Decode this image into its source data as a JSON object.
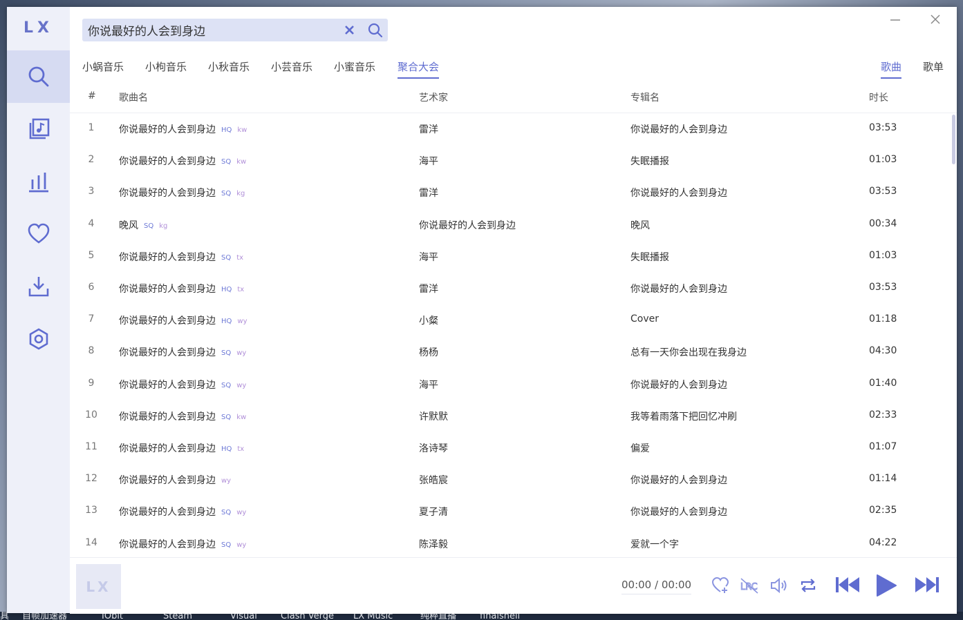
{
  "app": {
    "logo": "LX"
  },
  "colors": {
    "accent": "#5f6cd0",
    "quality_tag": "#6d79d6",
    "source_tag": "#b08fd8",
    "sidebar_bg": "#eef0f9"
  },
  "sidebar": {
    "items": [
      {
        "icon": "search-icon",
        "active": true
      },
      {
        "icon": "music-file-icon",
        "active": false
      },
      {
        "icon": "chart-icon",
        "active": false
      },
      {
        "icon": "heart-icon",
        "active": false
      },
      {
        "icon": "download-icon",
        "active": false
      },
      {
        "icon": "settings-icon",
        "active": false
      }
    ]
  },
  "search": {
    "value": "你说最好的人会到身边"
  },
  "source_tabs": [
    {
      "label": "小蜗音乐"
    },
    {
      "label": "小枸音乐"
    },
    {
      "label": "小秋音乐"
    },
    {
      "label": "小芸音乐"
    },
    {
      "label": "小蜜音乐"
    },
    {
      "label": "聚合大会",
      "active": true
    }
  ],
  "type_tabs": [
    {
      "label": "歌曲",
      "active": true
    },
    {
      "label": "歌单"
    }
  ],
  "table": {
    "headers": {
      "num": "#",
      "name": "歌曲名",
      "artist": "艺术家",
      "album": "专辑名",
      "duration": "时长"
    },
    "rows": [
      {
        "num": "1",
        "name": "你说最好的人会到身边",
        "quality": "HQ",
        "source": "kw",
        "artist": "雷洋",
        "album": "你说最好的人会到身边",
        "duration": "03:53"
      },
      {
        "num": "2",
        "name": "你说最好的人会到身边",
        "quality": "SQ",
        "source": "kw",
        "artist": "海平",
        "album": "失眠播报",
        "duration": "01:03"
      },
      {
        "num": "3",
        "name": "你说最好的人会到身边",
        "quality": "SQ",
        "source": "kg",
        "artist": "雷洋",
        "album": "你说最好的人会到身边",
        "duration": "03:53"
      },
      {
        "num": "4",
        "name": "晚风",
        "quality": "SQ",
        "source": "kg",
        "artist": "你说最好的人会到身边",
        "album": "晚风",
        "duration": "00:34"
      },
      {
        "num": "5",
        "name": "你说最好的人会到身边",
        "quality": "SQ",
        "source": "tx",
        "artist": "海平",
        "album": "失眠播报",
        "duration": "01:03"
      },
      {
        "num": "6",
        "name": "你说最好的人会到身边",
        "quality": "HQ",
        "source": "tx",
        "artist": "雷洋",
        "album": "你说最好的人会到身边",
        "duration": "03:53"
      },
      {
        "num": "7",
        "name": "你说最好的人会到身边",
        "quality": "HQ",
        "source": "wy",
        "artist": "小粲",
        "album": "Cover",
        "duration": "01:18"
      },
      {
        "num": "8",
        "name": "你说最好的人会到身边",
        "quality": "SQ",
        "source": "wy",
        "artist": "杨杨",
        "album": "总有一天你会出现在我身边",
        "duration": "04:30"
      },
      {
        "num": "9",
        "name": "你说最好的人会到身边",
        "quality": "SQ",
        "source": "wy",
        "artist": "海平",
        "album": "你说最好的人会到身边",
        "duration": "01:40"
      },
      {
        "num": "10",
        "name": "你说最好的人会到身边",
        "quality": "SQ",
        "source": "kw",
        "artist": "许默默",
        "album": "我等着雨落下把回忆冲刷",
        "duration": "02:33"
      },
      {
        "num": "11",
        "name": "你说最好的人会到身边",
        "quality": "HQ",
        "source": "tx",
        "artist": "洛诗琴",
        "album": "偏爱",
        "duration": "01:07"
      },
      {
        "num": "12",
        "name": "你说最好的人会到身边",
        "quality": "",
        "source": "wy",
        "artist": "张皓宸",
        "album": "你说最好的人会到身边",
        "duration": "01:14"
      },
      {
        "num": "13",
        "name": "你说最好的人会到身边",
        "quality": "SQ",
        "source": "wy",
        "artist": "夏子清",
        "album": "你说最好的人会到身边",
        "duration": "02:35"
      },
      {
        "num": "14",
        "name": "你说最好的人会到身边",
        "quality": "SQ",
        "source": "wy",
        "artist": "陈泽毅",
        "album": "爱就一个字",
        "duration": "04:22"
      }
    ]
  },
  "player": {
    "cover_text": "LX",
    "current_time": "00:00",
    "separator": "/",
    "total_time": "00:00",
    "controls": [
      "favorite-icon",
      "lyrics-icon",
      "volume-icon",
      "repeat-icon",
      "previous-icon",
      "play-icon",
      "next-icon"
    ]
  },
  "taskbar": {
    "items": [
      "具",
      "自帧加速器",
      "IObit",
      "Steam",
      "Visual",
      "Clash Verge",
      "LX Music",
      "纯粹直播",
      "finalshell"
    ]
  }
}
